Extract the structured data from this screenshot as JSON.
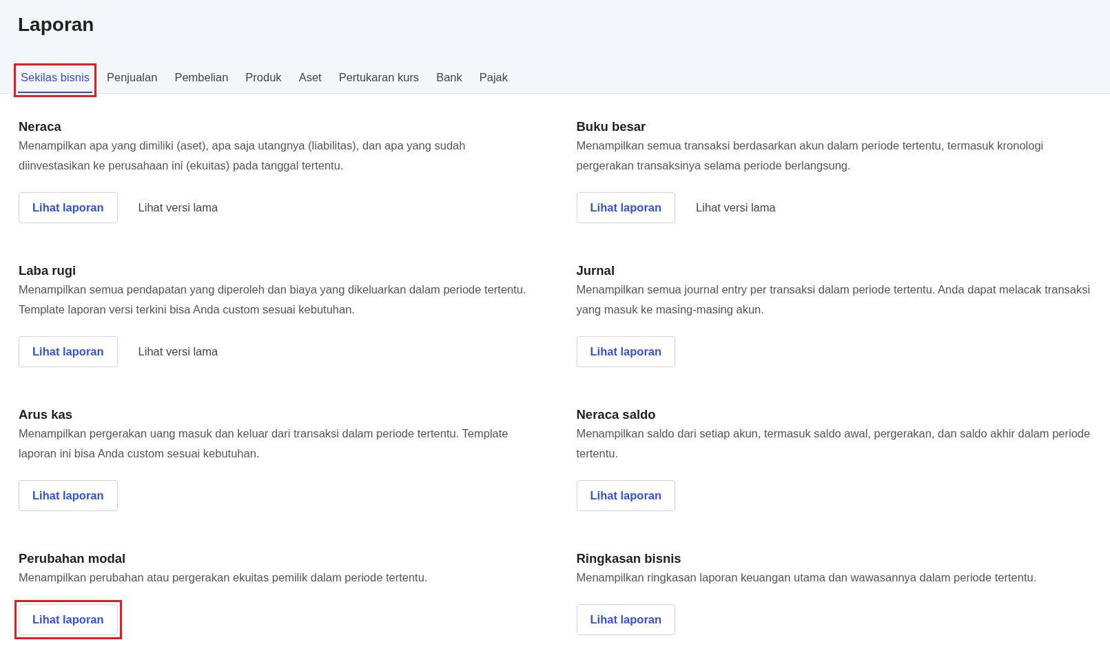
{
  "page": {
    "title": "Laporan"
  },
  "tabs": [
    {
      "label": "Sekilas bisnis",
      "selected": true,
      "highlighted": true
    },
    {
      "label": "Penjualan",
      "selected": false,
      "highlighted": false
    },
    {
      "label": "Pembelian",
      "selected": false,
      "highlighted": false
    },
    {
      "label": "Produk",
      "selected": false,
      "highlighted": false
    },
    {
      "label": "Aset",
      "selected": false,
      "highlighted": false
    },
    {
      "label": "Pertukaran kurs",
      "selected": false,
      "highlighted": false
    },
    {
      "label": "Bank",
      "selected": false,
      "highlighted": false
    },
    {
      "label": "Pajak",
      "selected": false,
      "highlighted": false
    }
  ],
  "reports": [
    {
      "title": "Neraca",
      "description": "Menampilkan apa yang dimiliki (aset), apa saja utangnya (liabilitas), dan apa yang sudah diinvestasikan ke perusahaan ini (ekuitas) pada tanggal tertentu.",
      "view_button": {
        "label": "Lihat laporan",
        "highlighted": false
      },
      "old_version_link": "Lihat versi lama"
    },
    {
      "title": "Buku besar",
      "description": "Menampilkan semua transaksi berdasarkan akun dalam periode tertentu, termasuk kronologi pergerakan transaksinya selama periode berlangsung.",
      "view_button": {
        "label": "Lihat laporan",
        "highlighted": false
      },
      "old_version_link": "Lihat versi lama"
    },
    {
      "title": "Laba rugi",
      "description": "Menampilkan semua pendapatan yang diperoleh dan biaya yang dikeluarkan dalam periode tertentu. Template laporan versi terkini bisa Anda custom sesuai kebutuhan.",
      "view_button": {
        "label": "Lihat laporan",
        "highlighted": false
      },
      "old_version_link": "Lihat versi lama"
    },
    {
      "title": "Jurnal",
      "description": "Menampilkan semua journal entry per transaksi dalam periode tertentu. Anda dapat melacak transaksi yang masuk ke masing-masing akun.",
      "view_button": {
        "label": "Lihat laporan",
        "highlighted": false
      }
    },
    {
      "title": "Arus kas",
      "description": "Menampilkan pergerakan uang masuk dan keluar dari transaksi dalam periode tertentu. Template laporan ini bisa Anda custom sesuai kebutuhan.",
      "view_button": {
        "label": "Lihat laporan",
        "highlighted": false
      }
    },
    {
      "title": "Neraca saldo",
      "description": "Menampilkan saldo dari setiap akun, termasuk saldo awal, pergerakan, dan saldo akhir dalam periode tertentu.",
      "view_button": {
        "label": "Lihat laporan",
        "highlighted": false
      }
    },
    {
      "title": "Perubahan modal",
      "description": "Menampilkan perubahan atau pergerakan ekuitas pemilik dalam periode tertentu.",
      "view_button": {
        "label": "Lihat laporan",
        "highlighted": true
      }
    },
    {
      "title": "Ringkasan bisnis",
      "description": "Menampilkan ringkasan laporan keuangan utama dan wawasannya dalam periode tertentu.",
      "view_button": {
        "label": "Lihat laporan",
        "highlighted": false
      }
    }
  ]
}
